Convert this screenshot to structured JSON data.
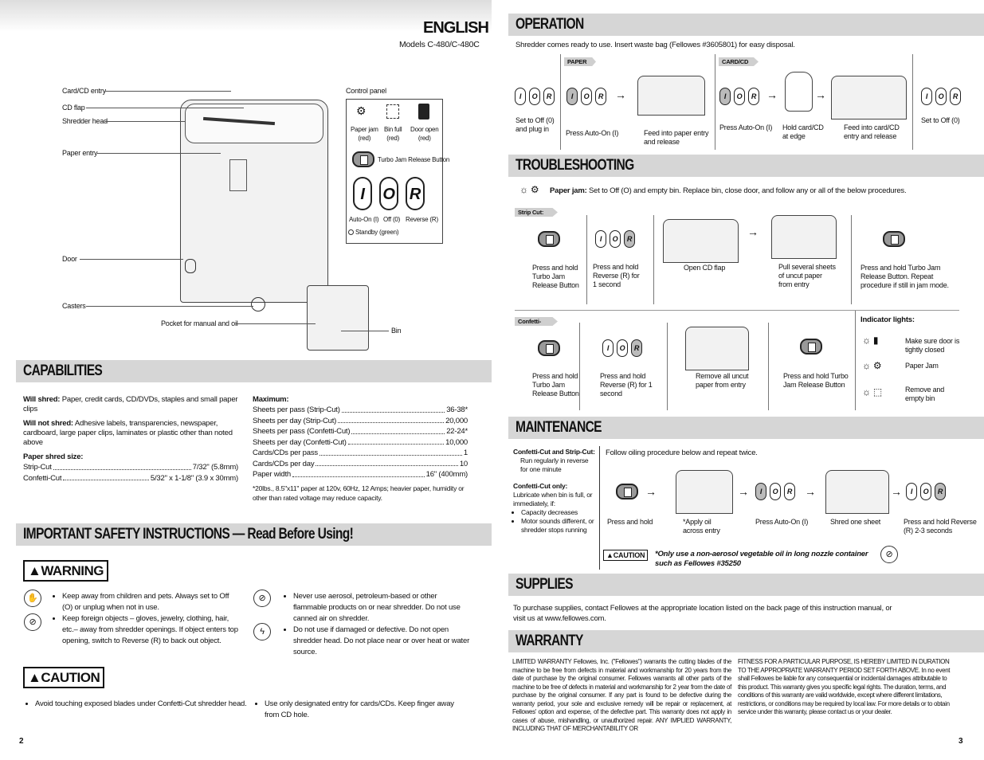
{
  "left_page": {
    "heading": "ENGLISH",
    "models": "Models C-480/C-480C",
    "page_number": "2",
    "diagram": {
      "card_cd_entry": "Card/CD entry",
      "cd_flap": "CD flap",
      "shredder_head": "Shredder head",
      "paper_entry": "Paper entry",
      "door": "Door",
      "casters": "Casters",
      "pocket": "Pocket for manual and oil",
      "bin": "Bin",
      "control_panel": "Control panel",
      "paper_jam": "Paper jam\n(red)",
      "bin_full": "Bin full\n(red)",
      "door_open": "Door open\n(red)",
      "turbo_jam": "Turbo Jam Release Button",
      "auto_on": "Auto-On (I)",
      "off": "Off (0)",
      "reverse": "Reverse (R)",
      "standby": "Standby (green)"
    },
    "capabilities": {
      "title": "CAPABILITIES",
      "will_shred_label": "Will shred:",
      "will_shred": "Paper, credit cards, CD/DVDs, staples and small paper clips",
      "will_not_label": "Will not shred:",
      "will_not": "Adhesive labels, transparencies, newspaper, cardboard, large paper clips, laminates or plastic other than noted above",
      "shred_size_label": "Paper shred size:",
      "shred_sizes": [
        {
          "k": "Strip-Cut",
          "v": "7/32\" (5.8mm)"
        },
        {
          "k": "Confetti-Cut",
          "v": "5/32\" x 1-1/8\" (3.9 x 30mm)"
        }
      ],
      "max_label": "Maximum:",
      "max": [
        {
          "k": "Sheets per pass (Strip-Cut)",
          "v": "36-38*"
        },
        {
          "k": "Sheets per day (Strip-Cut)",
          "v": "20,000"
        },
        {
          "k": "Sheets per pass (Confetti-Cut)",
          "v": "22-24*"
        },
        {
          "k": "Sheets per day (Confetti-Cut)",
          "v": "10,000"
        },
        {
          "k": "Cards/CDs per pass",
          "v": "1"
        },
        {
          "k": "Cards/CDs per day",
          "v": "10"
        },
        {
          "k": "Paper width",
          "v": "16\" (400mm)"
        }
      ],
      "footnote": "*20lbs., 8.5\"x11\" paper at 120v, 60Hz, 12 Amps; heavier paper, humidity or other than rated voltage may reduce capacity."
    },
    "safety": {
      "title": "IMPORTANT SAFETY INSTRUCTIONS — Read Before Using!",
      "warning": "WARNING",
      "caution": "CAUTION",
      "warnings": [
        "Keep away from children and pets. Always set to Off (O) or unplug when not in use.",
        "Keep foreign objects – gloves, jewelry, clothing, hair, etc.– away from shredder openings. If object enters top opening, switch to Reverse (R) to back out object.",
        "Never use aerosol, petroleum-based or other flammable products on or near shredder. Do not use canned air on shredder.",
        "Do not use if damaged or defective. Do not open shredder head. Do not place near or over heat or water source."
      ],
      "cautions": [
        "Avoid touching exposed blades under Confetti-Cut shredder head.",
        "Use only designated entry for cards/CDs. Keep finger away from CD hole."
      ]
    }
  },
  "ior": {
    "i": "I",
    "o": "O",
    "r": "R"
  },
  "right_page": {
    "page_number": "3",
    "operation": {
      "title": "OPERATION",
      "intro": "Shredder comes ready to use. Insert waste bag (Fellowes #3605801) for easy disposal.",
      "paper_tag": "PAPER",
      "card_tag": "CARD/CD",
      "steps": [
        "Set to Off (0)\nand plug in",
        "Press Auto-On (I)",
        "Feed into paper entry\nand release",
        "Press Auto-On (I)",
        "Hold card/CD\nat edge",
        "Feed into card/CD\nentry and release",
        "Set to Off (0)"
      ]
    },
    "troubleshooting": {
      "title": "TROUBLESHOOTING",
      "jam_label": "Paper jam:",
      "jam_text": "Set to Off (O) and empty bin. Replace bin, close door, and follow any or all of the below procedures.",
      "strip_tag": "Strip Cut:",
      "strip_steps": [
        "Press and hold\nTurbo Jam\nRelease Button",
        "Press and hold\nReverse (R) for\n1 second",
        "Open CD flap",
        "Pull several sheets\nof uncut paper\nfrom entry",
        "Press and hold Turbo Jam\nRelease Button. Repeat\nprocedure if still in jam mode."
      ],
      "confetti_tag": "Confetti-Cut:",
      "confetti_steps": [
        "Press and hold\nTurbo Jam\nRelease Button",
        "Press and hold\nReverse (R) for 1\nsecond",
        "Remove all uncut\npaper from entry",
        "Press and hold Turbo\nJam Release Button"
      ],
      "indicator_title": "Indicator lights:",
      "indicators": [
        "Make sure door is\ntightly closed",
        "Paper Jam",
        "Remove and\nempty bin"
      ]
    },
    "maintenance": {
      "title": "MAINTENANCE",
      "both_label": "Confetti-Cut and Strip-Cut:",
      "both_text": "Run regularly in reverse for one minute",
      "confetti_label": "Confetti-Cut only:",
      "confetti_text": "Lubricate when bin is full, or immediately, if:",
      "bullets": [
        "Capacity decreases",
        "Motor sounds different, or shredder stops running"
      ],
      "intro": "Follow oiling procedure below and repeat twice.",
      "steps": [
        "Press and hold",
        "*Apply oil\nacross entry",
        "Press Auto-On (I)",
        "Shred one sheet",
        "Press and hold Reverse\n(R) 2-3 seconds"
      ],
      "caution": "CAUTION",
      "caution_text": "*Only use a non-aerosol vegetable oil in long nozzle container such as Fellowes #35250"
    },
    "supplies": {
      "title": "SUPPLIES",
      "text": "To purchase supplies, contact Fellowes at the appropriate location listed on the back page of this instruction manual, or visit us at www.fellowes.com."
    },
    "warranty": {
      "title": "WARRANTY",
      "col1": "LIMITED WARRANTY Fellowes, Inc. (\"Fellowes\") warrants the cutting blades of the machine to be free from defects in material and workmanship for 20 years from the date of purchase by the original consumer. Fellowes warrants all other parts of the machine to be free of defects in material and workmanship for 2 year from the date of purchase by the original consumer. If any part is found to be defective during the warranty period, your sole and exclusive remedy will be repair or replacement, at Fellowes' option and expense, of the defective part. This warranty does not apply in cases of abuse, mishandling, or unauthorized repair. ANY IMPLIED WARRANTY, INCLUDING THAT OF MERCHANTABILITY OR",
      "col2": "FITNESS FOR A PARTICULAR PURPOSE, IS HEREBY LIMITED IN DURATION TO THE APPROPRIATE WARRANTY PERIOD SET FORTH ABOVE. In no event shall Fellowes be liable for any consequential or incidental damages attributable to this product. This warranty gives you specific legal rights. The duration, terms, and conditions of this warranty are valid worldwide, except where different limitations, restrictions, or conditions may be required by local law. For more details or to obtain service under this warranty, please contact us or your dealer."
    }
  }
}
